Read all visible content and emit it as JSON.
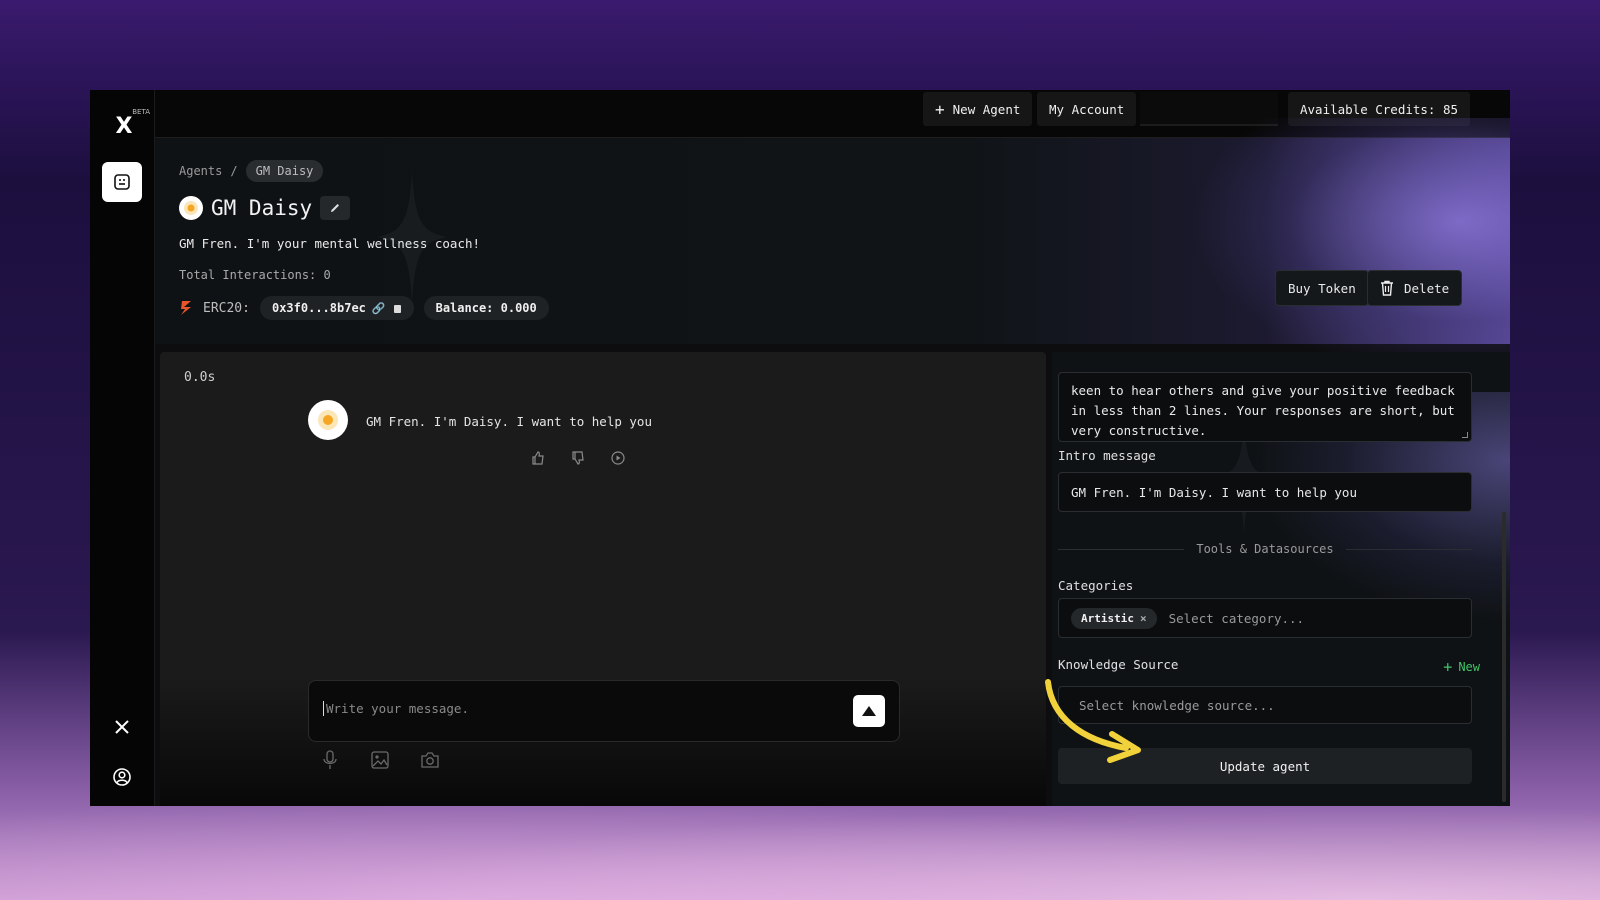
{
  "app": {
    "logo_text": "X",
    "beta_label": "BETA"
  },
  "topbar": {
    "new_agent_label": "New Agent",
    "my_account_label": "My Account",
    "credits_label": "Available Credits: 85"
  },
  "breadcrumb": {
    "root": "Agents",
    "separator": "/",
    "current": "GM Daisy"
  },
  "agent": {
    "name": "GM Daisy",
    "description": "GM Fren. I'm your mental wellness coach!",
    "interactions": "Total Interactions: 0",
    "token_standard": "ERC20:",
    "address": "0x3f0...8b7ec",
    "balance": "Balance: 0.000"
  },
  "header_actions": {
    "buy_token_label": "Buy Token",
    "delete_label": "Delete"
  },
  "chat": {
    "timer": "0.0s",
    "messages": [
      {
        "text": "GM Fren. I'm Daisy. I want to help you"
      }
    ],
    "composer_placeholder": "Write your message."
  },
  "settings": {
    "system_prompt_visible": "keen to hear others and give your positive feedback in less than 2 lines. Your responses are short, but very constructive.",
    "intro_label": "Intro message",
    "intro_value": "GM Fren. I'm Daisy. I want to help you",
    "section_title": "Tools & Datasources",
    "categories_label": "Categories",
    "category_tags": [
      "Artistic"
    ],
    "category_placeholder": "Select category...",
    "knowledge_label": "Knowledge Source",
    "knowledge_new_label": "New",
    "knowledge_placeholder": "Select knowledge source...",
    "update_label": "Update agent"
  },
  "colors": {
    "accent_green": "#3fc46a",
    "annotation_arrow": "#f2d23a",
    "token_icon": "#e8552b"
  },
  "icons": {
    "sidebar_agents": "agent-face-icon",
    "sidebar_x": "x-logo-icon",
    "sidebar_account": "user-circle-icon"
  }
}
